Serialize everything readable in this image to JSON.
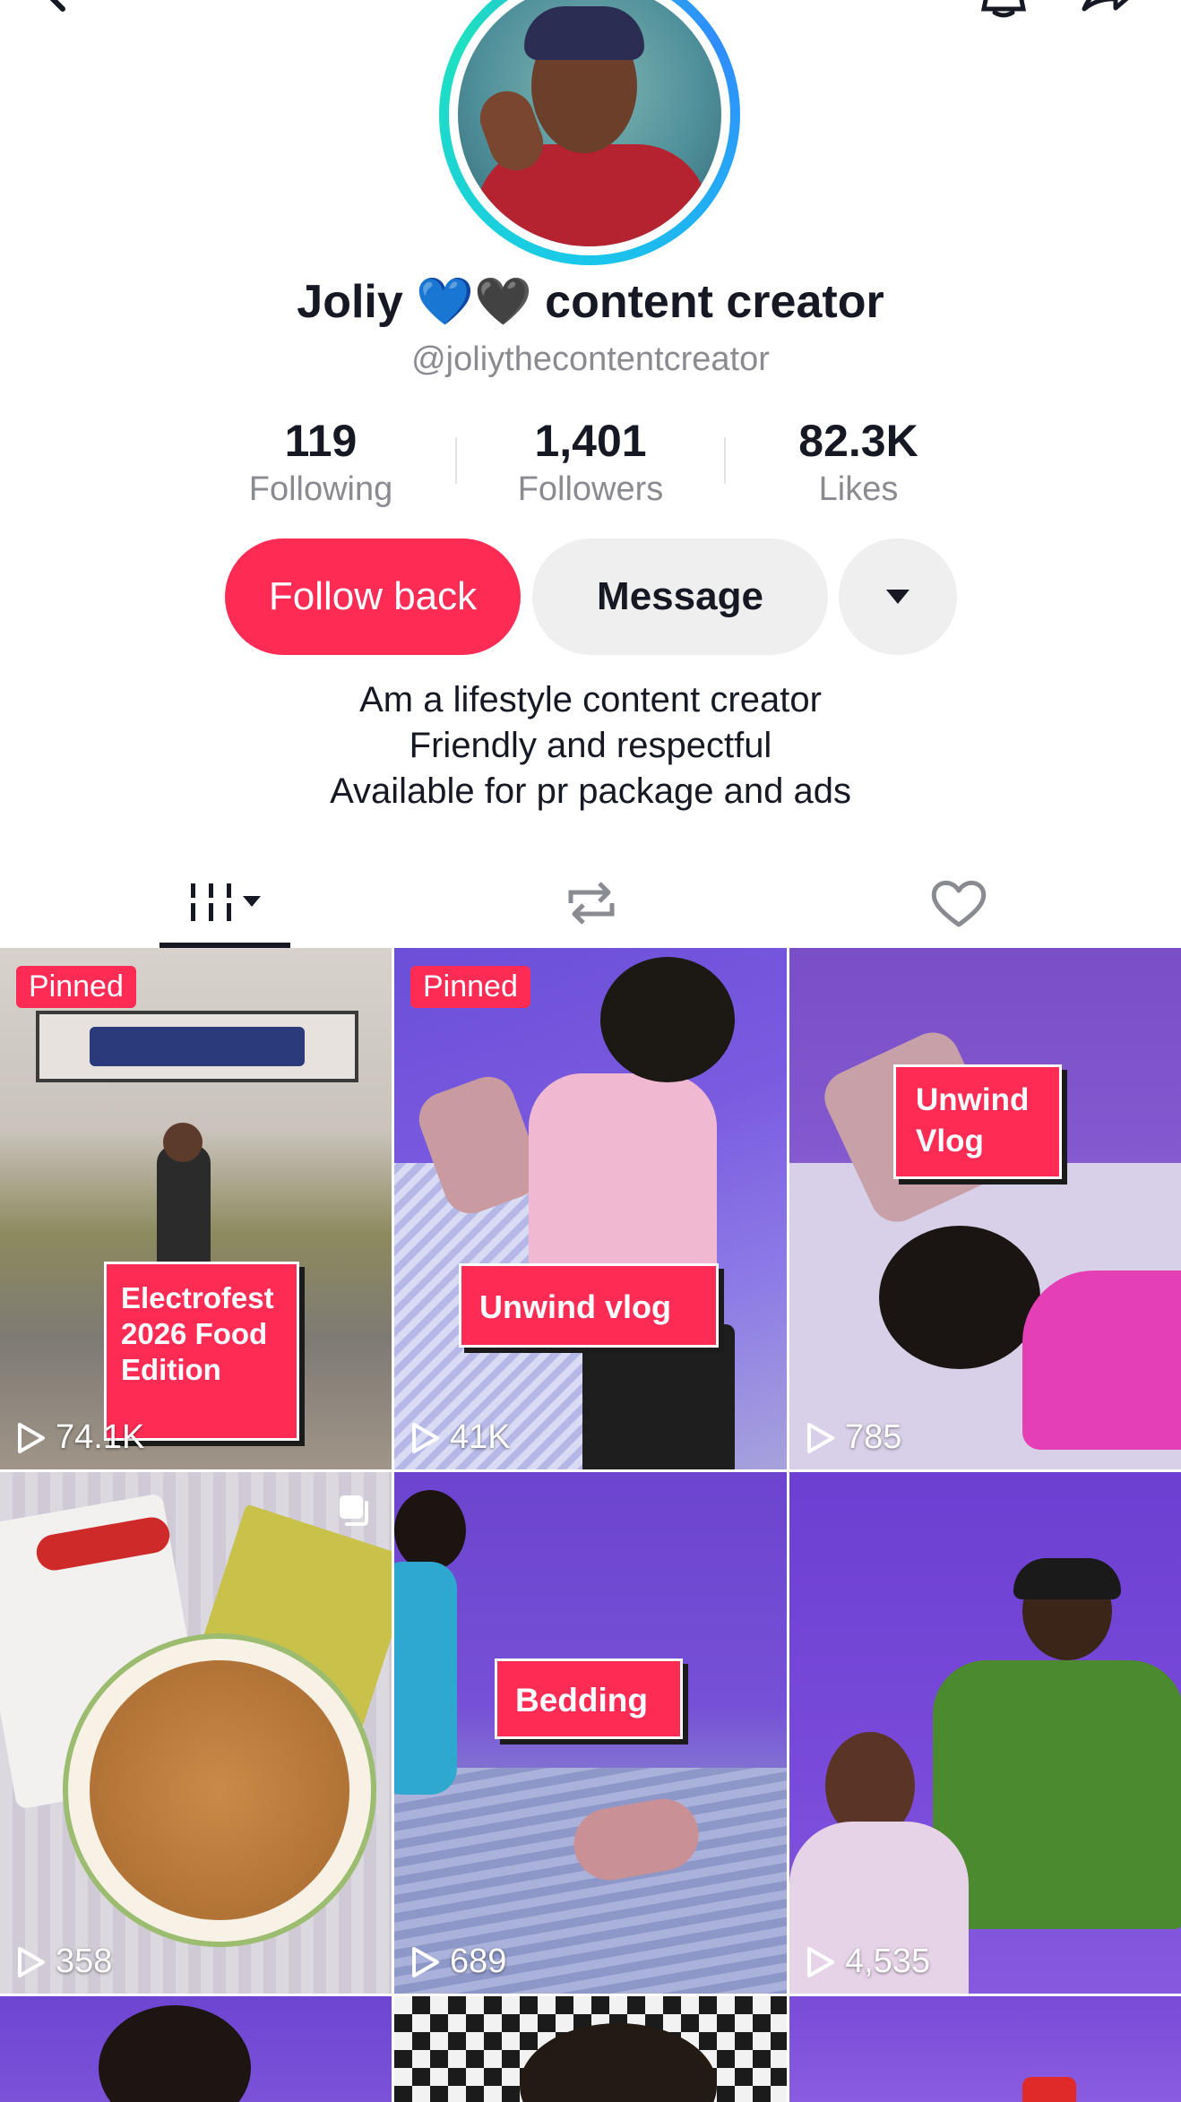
{
  "profile": {
    "display_name": "Joliy 💙🖤 content creator",
    "username": "@joliythecontentcreator",
    "bio": [
      "Am a lifestyle content creator",
      "Friendly and respectful",
      "Available for pr package and ads"
    ]
  },
  "stats": [
    {
      "value": "119",
      "label": "Following"
    },
    {
      "value": "1,401",
      "label": "Followers"
    },
    {
      "value": "82.3K",
      "label": "Likes"
    }
  ],
  "actions": {
    "follow_label": "Follow back",
    "message_label": "Message"
  },
  "icons": {
    "back": "back-icon",
    "notifications": "bell-icon",
    "share": "share-icon",
    "more": "caret-down-icon",
    "videos_tab": "grid-icon",
    "reposts_tab": "repost-icon",
    "liked_tab": "heart-icon",
    "play": "play-icon",
    "multi": "photo-carousel-icon"
  },
  "colors": {
    "accent": "#fe2c55",
    "text": "#161823",
    "muted": "#8a8b91"
  },
  "videos": [
    {
      "pinned_label": "Pinned",
      "caption": "Electrofest 2026 Food Edition",
      "views": "74.1K"
    },
    {
      "pinned_label": "Pinned",
      "caption": "Unwind vlog",
      "views": "41K"
    },
    {
      "pinned_label": "",
      "caption": "Unwind Vlog",
      "views": "785"
    },
    {
      "pinned_label": "",
      "caption": "",
      "views": "358"
    },
    {
      "pinned_label": "",
      "caption": "Bedding",
      "views": "689"
    },
    {
      "pinned_label": "",
      "caption": "",
      "views": "4,535"
    }
  ]
}
